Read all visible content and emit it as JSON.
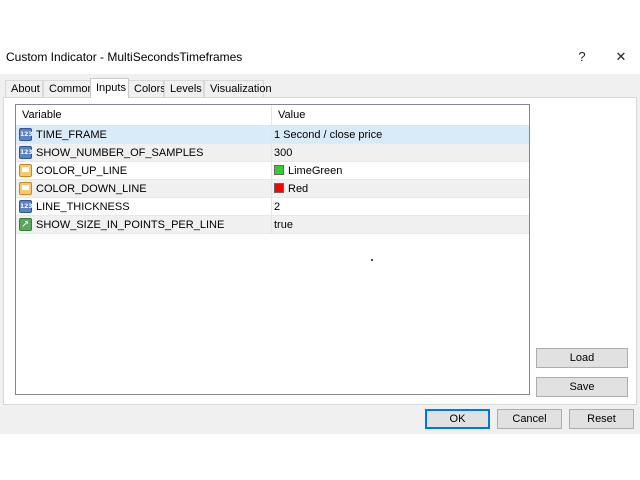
{
  "window": {
    "title": "Custom Indicator - MultiSecondsTimeframes",
    "help_label": "?",
    "close_label": "✕"
  },
  "tabs": [
    {
      "label": "About"
    },
    {
      "label": "Common"
    },
    {
      "label": "Inputs"
    },
    {
      "label": "Colors"
    },
    {
      "label": "Levels"
    },
    {
      "label": "Visualization"
    }
  ],
  "active_tab": "Inputs",
  "table": {
    "columns": [
      "Variable",
      "Value"
    ],
    "rows": [
      {
        "icon": "number-icon",
        "variable": "TIME_FRAME",
        "value": "1 Second / close price"
      },
      {
        "icon": "number-icon",
        "variable": "SHOW_NUMBER_OF_SAMPLES",
        "value": "300"
      },
      {
        "icon": "color-icon",
        "variable": "COLOR_UP_LINE",
        "value": "LimeGreen",
        "swatch": "#32cd32"
      },
      {
        "icon": "color-icon",
        "variable": "COLOR_DOWN_LINE",
        "value": "Red",
        "swatch": "#ff0000"
      },
      {
        "icon": "number-icon",
        "variable": "LINE_THICKNESS",
        "value": "2"
      },
      {
        "icon": "boolean-icon",
        "variable": "SHOW_SIZE_IN_POINTS_PER_LINE",
        "value": "true"
      }
    ]
  },
  "side_buttons": {
    "load": "Load",
    "save": "Save"
  },
  "footer_buttons": {
    "ok": "OK",
    "cancel": "Cancel",
    "reset": "Reset"
  },
  "colors": {
    "accent": "#0078d7",
    "selected_row": "#d9ebf9"
  }
}
